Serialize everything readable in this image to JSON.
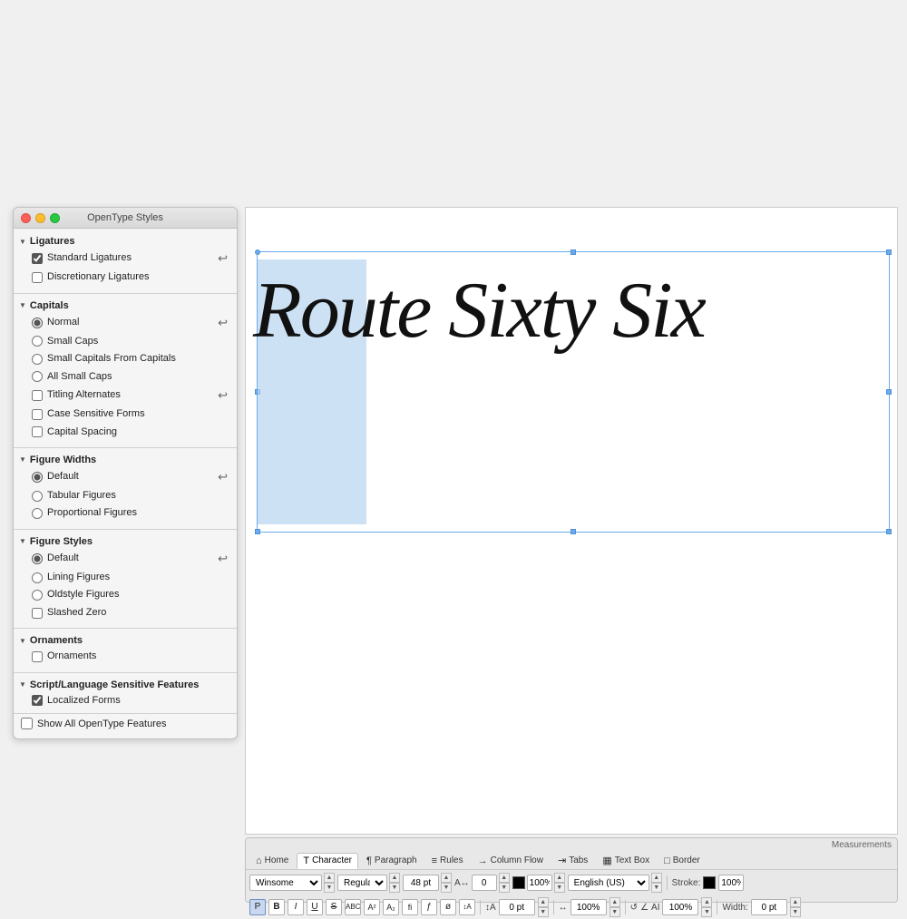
{
  "panel": {
    "title": "OpenType Styles",
    "sections": {
      "ligatures": {
        "label": "Ligatures",
        "items": [
          {
            "type": "checkbox",
            "label": "Standard Ligatures",
            "checked": true,
            "hasIcon": true
          },
          {
            "type": "checkbox",
            "label": "Discretionary Ligatures",
            "checked": false,
            "hasIcon": false
          }
        ]
      },
      "capitals": {
        "label": "Capitals",
        "items": [
          {
            "type": "radio",
            "label": "Normal",
            "checked": true,
            "hasIcon": true
          },
          {
            "type": "radio",
            "label": "Small Caps",
            "checked": false
          },
          {
            "type": "radio",
            "label": "Small Capitals From Capitals",
            "checked": false
          },
          {
            "type": "radio",
            "label": "All Small Caps",
            "checked": false
          },
          {
            "type": "checkbox",
            "label": "Titling Alternates",
            "checked": false,
            "hasIcon": true
          },
          {
            "type": "checkbox",
            "label": "Case Sensitive Forms",
            "checked": false
          },
          {
            "type": "checkbox",
            "label": "Capital Spacing",
            "checked": false
          }
        ]
      },
      "figureWidths": {
        "label": "Figure Widths",
        "items": [
          {
            "type": "radio",
            "label": "Default",
            "checked": true,
            "hasIcon": true
          },
          {
            "type": "radio",
            "label": "Tabular Figures",
            "checked": false
          },
          {
            "type": "radio",
            "label": "Proportional Figures",
            "checked": false
          }
        ]
      },
      "figureStyles": {
        "label": "Figure Styles",
        "items": [
          {
            "type": "radio",
            "label": "Default",
            "checked": true,
            "hasIcon": true
          },
          {
            "type": "radio",
            "label": "Lining Figures",
            "checked": false
          },
          {
            "type": "radio",
            "label": "Oldstyle Figures",
            "checked": false
          },
          {
            "type": "checkbox",
            "label": "Slashed Zero",
            "checked": false
          }
        ]
      },
      "ornaments": {
        "label": "Ornaments",
        "items": [
          {
            "type": "checkbox",
            "label": "Ornaments",
            "checked": false
          }
        ]
      },
      "scriptLanguage": {
        "label": "Script/Language Sensitive Features",
        "items": [
          {
            "type": "checkbox",
            "label": "Localized Forms",
            "checked": true
          }
        ]
      }
    },
    "showAll": {
      "label": "Show All OpenType Features",
      "checked": false
    }
  },
  "canvas": {
    "text": "Route Sixty Six"
  },
  "measurements": {
    "title": "Measurements",
    "tabs": [
      {
        "label": "Home",
        "icon": "⌂",
        "active": false
      },
      {
        "label": "Character",
        "icon": "T",
        "active": true
      },
      {
        "label": "Paragraph",
        "icon": "¶",
        "active": false
      },
      {
        "label": "Rules",
        "icon": "≡",
        "active": false
      },
      {
        "label": "Column Flow",
        "icon": "→",
        "active": false
      },
      {
        "label": "Tabs",
        "icon": "⇥",
        "active": false
      },
      {
        "label": "Text Box",
        "icon": "▦",
        "active": false
      },
      {
        "label": "Border",
        "icon": "□",
        "active": false
      }
    ],
    "row1": {
      "font": "Winsome",
      "style": "Regular",
      "size": "48 pt",
      "kern": "0",
      "color_pct": "100%",
      "language": "English (US)",
      "stroke_label": "Stroke:",
      "stroke_pct": "100%"
    },
    "row2": {
      "paragraph_btn": "P",
      "bold": "B",
      "italic": "I",
      "underline": "U",
      "strikethrough": "S",
      "allcaps": "ABC",
      "superscript": "A²",
      "subscript": "A₂",
      "fi_lig": "fi",
      "frac": "ƒ",
      "no_break": "ø",
      "fl_lig": "fA",
      "baseline_shift": "↕A",
      "baseline_val": "0 pt",
      "scale_h": "100%",
      "rotate_icon": "↺",
      "angle_icon": "∠",
      "ai_label": "AI",
      "ai_val": "100%",
      "width_label": "Width:",
      "width_val": "0 pt"
    }
  }
}
